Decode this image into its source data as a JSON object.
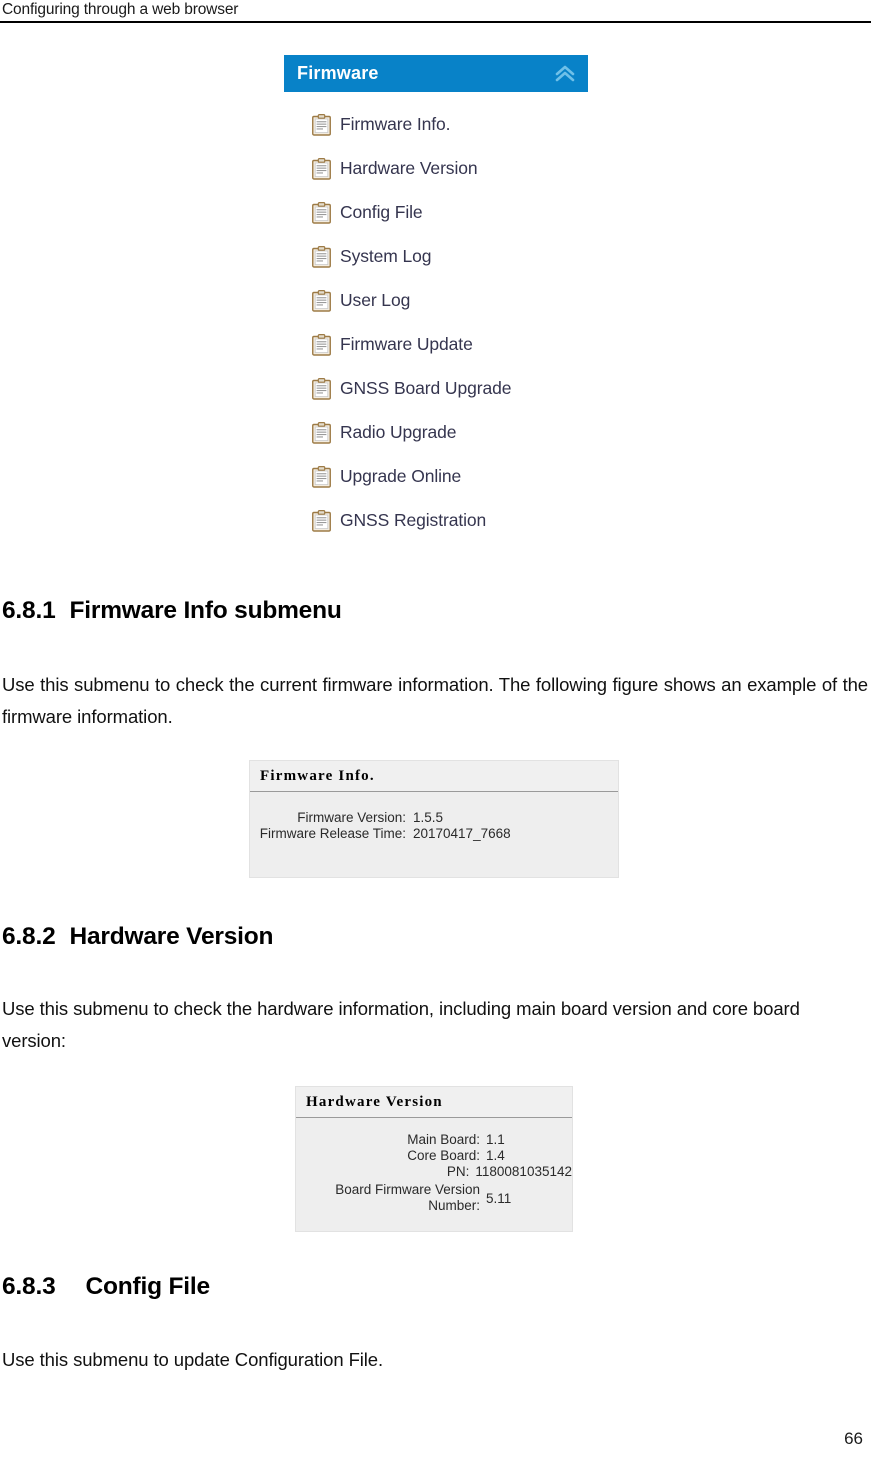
{
  "header": {
    "running_head": "Configuring through a web browser"
  },
  "menu_panel": {
    "title": "Firmware",
    "collapse_icon": "chevron-up-icon",
    "header_color": "#0882c8",
    "items": [
      {
        "icon": "clipboard-icon",
        "label": "Firmware Info."
      },
      {
        "icon": "clipboard-icon",
        "label": "Hardware Version"
      },
      {
        "icon": "clipboard-icon",
        "label": "Config File"
      },
      {
        "icon": "clipboard-icon",
        "label": "System Log"
      },
      {
        "icon": "clipboard-icon",
        "label": "User Log"
      },
      {
        "icon": "clipboard-icon",
        "label": "Firmware Update"
      },
      {
        "icon": "clipboard-icon",
        "label": "GNSS Board Upgrade"
      },
      {
        "icon": "clipboard-icon",
        "label": "Radio Upgrade"
      },
      {
        "icon": "clipboard-icon",
        "label": "Upgrade Online"
      },
      {
        "icon": "clipboard-icon",
        "label": "GNSS Registration"
      }
    ]
  },
  "sections": {
    "s681": {
      "number": "6.8.1",
      "title": "Firmware Info submenu",
      "body": "Use this submenu to check the current firmware information. The following figure shows an example of the firmware information."
    },
    "s682": {
      "number": "6.8.2",
      "title": "Hardware Version",
      "body": "Use this submenu to check the hardware information, including main board version and core board version:"
    },
    "s683": {
      "number": "6.8.3",
      "title": "Config File",
      "body": "Use this submenu to update Configuration File."
    }
  },
  "firmware_info_box": {
    "title": "Firmware Info.",
    "rows": [
      {
        "label": "Firmware Version:",
        "value": "1.5.5"
      },
      {
        "label": "Firmware Release Time:",
        "value": "20170417_7668"
      }
    ]
  },
  "hardware_version_box": {
    "title": "Hardware Version",
    "rows": [
      {
        "label": "Main Board:",
        "value": "1.1"
      },
      {
        "label": "Core Board:",
        "value": "1.4"
      },
      {
        "label": "PN:",
        "value": "1180081035142"
      },
      {
        "label": "Board Firmware Version\nNumber:",
        "value": "5.11"
      }
    ]
  },
  "footer": {
    "page_number": "66"
  }
}
